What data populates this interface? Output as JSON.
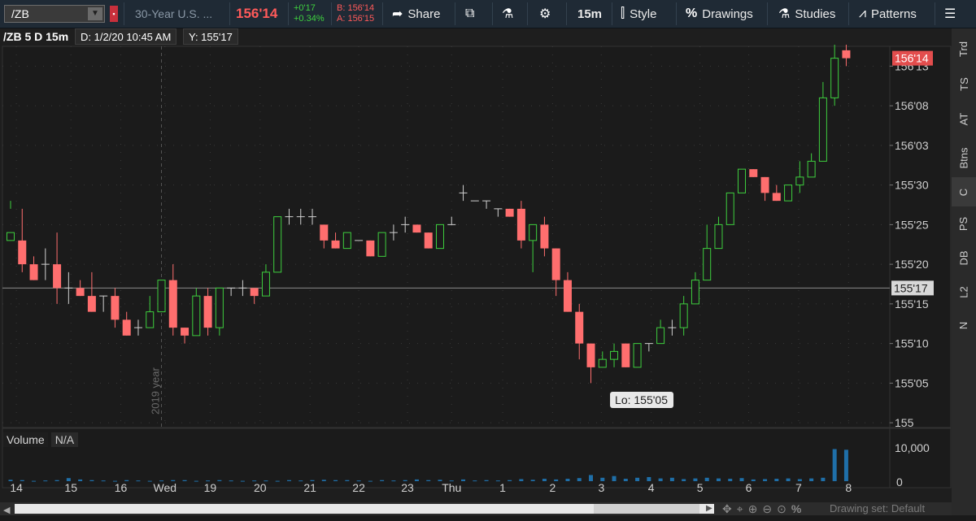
{
  "toolbar": {
    "symbol": "/ZB",
    "description": "30-Year U.S. ...",
    "last_price": "156'14",
    "change": "+0'17",
    "change_pct": "+0.34%",
    "bid": "B: 156'14",
    "ask": "A: 156'15",
    "share_label": "Share",
    "timeframe_label": "15m",
    "style_label": "Style",
    "drawings_label": "Drawings",
    "studies_label": "Studies",
    "patterns_label": "Patterns"
  },
  "chart_header": {
    "symbol_period": "/ZB 5 D 15m",
    "cursor_date": "D: 1/2/20 10:45 AM",
    "cursor_y": "Y: 155'17"
  },
  "side_tabs": [
    "Trd",
    "TS",
    "AT",
    "Btns",
    "C",
    "PS",
    "DB",
    "L2",
    "N"
  ],
  "volume": {
    "label": "Volume",
    "value": "N/A"
  },
  "scrollbar": {
    "drawing_set": "Drawing set: Default"
  },
  "colors": {
    "up": "#3ecf3e",
    "down": "#ff6e6e",
    "price_tag": "#e34d4d",
    "volume": "#1f6fa8"
  },
  "chart_data": {
    "type": "candlestick",
    "y_tick_labels": [
      "156'13",
      "156'08",
      "156'03",
      "155'30",
      "155'25",
      "155'20",
      "155'15",
      "155'10",
      "155'05",
      "155"
    ],
    "y_ticks_32nds": [
      13,
      8,
      3,
      -2,
      -7,
      -12,
      -17,
      -22,
      -27,
      -32
    ],
    "y_range_32nds_rel_156": [
      -32.5,
      15.5
    ],
    "x_tick_labels": [
      {
        "label": "14",
        "bar": 0.5
      },
      {
        "label": "15",
        "bar": 5.2
      },
      {
        "label": "16",
        "bar": 9.5
      },
      {
        "label": "Wed",
        "bar": 13.3
      },
      {
        "label": "19",
        "bar": 17.2
      },
      {
        "label": "20",
        "bar": 21.5
      },
      {
        "label": "21",
        "bar": 25.8
      },
      {
        "label": "22",
        "bar": 30.0
      },
      {
        "label": "23",
        "bar": 34.2
      },
      {
        "label": "Thu",
        "bar": 38.0
      },
      {
        "label": "1",
        "bar": 42.4
      },
      {
        "label": "2",
        "bar": 46.7
      },
      {
        "label": "3",
        "bar": 50.9
      },
      {
        "label": "4",
        "bar": 55.2
      },
      {
        "label": "5",
        "bar": 59.4
      },
      {
        "label": "6",
        "bar": 63.6
      },
      {
        "label": "7",
        "bar": 67.9
      },
      {
        "label": "8",
        "bar": 72.2
      }
    ],
    "year_marker": {
      "label": "2019 year",
      "bar": 13.0
    },
    "crosshair_price_label": "155'17",
    "crosshair_value": -15,
    "current_price_label": "156'14",
    "current_value": 14,
    "low_label": "Lo: 155'05",
    "low_bar": 52,
    "volume_ticks": [
      "10,000",
      "0"
    ],
    "volume_max": 10000,
    "candles": [
      [
        -9,
        -8,
        -5,
        -4
      ],
      [
        -9,
        -12,
        -13,
        -5
      ],
      [
        -12,
        -14,
        -14,
        -11
      ],
      [
        -12,
        -12,
        -14,
        -10
      ],
      [
        -12,
        -15,
        -17,
        -8
      ],
      [
        -15,
        -15,
        -17,
        -13
      ],
      [
        -15,
        -16,
        -16,
        -14
      ],
      [
        -16,
        -18,
        -18,
        -13
      ],
      [
        -16,
        -16,
        -18,
        -16
      ],
      [
        -16,
        -19,
        -20,
        -15
      ],
      [
        -19,
        -21,
        -21,
        -18
      ],
      [
        -20,
        -20,
        -21,
        -19
      ],
      [
        -20,
        -18,
        -20,
        -16
      ],
      [
        -18,
        -14,
        -18,
        -14
      ],
      [
        -14,
        -20,
        -21,
        -12
      ],
      [
        -20,
        -21,
        -22,
        -20
      ],
      [
        -21,
        -16,
        -21,
        -15
      ],
      [
        -16,
        -20,
        -21,
        -15
      ],
      [
        -20,
        -15,
        -21,
        -15
      ],
      [
        -15,
        -15,
        -16,
        -15
      ],
      [
        -15,
        -15,
        -16,
        -14
      ],
      [
        -15,
        -16,
        -17,
        -15
      ],
      [
        -16,
        -13,
        -16,
        -12
      ],
      [
        -13,
        -6,
        -13,
        -6
      ],
      [
        -6,
        -6,
        -7,
        -5
      ],
      [
        -6,
        -6,
        -7,
        -5
      ],
      [
        -6,
        -6,
        -7,
        -5
      ],
      [
        -7,
        -9,
        -10,
        -7
      ],
      [
        -9,
        -10,
        -10,
        -8
      ],
      [
        -10,
        -8,
        -10,
        -8
      ],
      [
        -9,
        -9,
        -9,
        -9
      ],
      [
        -9,
        -11,
        -11,
        -9
      ],
      [
        -11,
        -8,
        -11,
        -8
      ],
      [
        -8,
        -8,
        -9,
        -7
      ],
      [
        -7,
        -7,
        -8,
        -6
      ],
      [
        -7,
        -8,
        -8,
        -7
      ],
      [
        -8,
        -10,
        -10,
        -8
      ],
      [
        -10,
        -7,
        -10,
        -7
      ],
      [
        -7,
        -7,
        -7,
        -6
      ],
      [
        -3,
        -3,
        -4,
        -2
      ],
      [
        -4,
        -4,
        -4,
        -4
      ],
      [
        -4,
        -4,
        -5,
        -4
      ],
      [
        -5,
        -5,
        -6,
        -5
      ],
      [
        -5,
        -6,
        -6,
        -5
      ],
      [
        -5,
        -9,
        -10,
        -4
      ],
      [
        -9,
        -7,
        -13,
        -7
      ],
      [
        -7,
        -10,
        -11,
        -6
      ],
      [
        -10,
        -14,
        -16,
        -10
      ],
      [
        -14,
        -18,
        -18,
        -13
      ],
      [
        -18,
        -22,
        -24,
        -17
      ],
      [
        -22,
        -25,
        -27,
        -22
      ],
      [
        -25,
        -24,
        -25,
        -23
      ],
      [
        -24,
        -23,
        -25,
        -22
      ],
      [
        -22,
        -25,
        -25,
        -22
      ],
      [
        -25,
        -22,
        -25,
        -22
      ],
      [
        -22,
        -22,
        -23,
        -22
      ],
      [
        -22,
        -20,
        -21,
        -19
      ],
      [
        -20,
        -20,
        -21,
        -19
      ],
      [
        -20,
        -17,
        -21,
        -16
      ],
      [
        -17,
        -14,
        -17,
        -13
      ],
      [
        -14,
        -10,
        -14,
        -7
      ],
      [
        -10,
        -7,
        -10,
        -6
      ],
      [
        -7,
        -3,
        -7,
        -3
      ],
      [
        -3,
        0,
        -3,
        0
      ],
      [
        0,
        -1,
        -1,
        0
      ],
      [
        -1,
        -3,
        -4,
        -1
      ],
      [
        -3,
        -4,
        -4,
        -2
      ],
      [
        -4,
        -2,
        -4,
        -2
      ],
      [
        -2,
        -1,
        -3,
        1
      ],
      [
        -1,
        1,
        -1,
        2
      ],
      [
        1,
        9,
        1,
        11
      ],
      [
        9,
        14,
        8,
        16
      ],
      [
        15,
        14,
        13,
        16
      ]
    ],
    "volume": [
      400,
      300,
      100,
      200,
      300,
      900,
      500,
      300,
      200,
      100,
      300,
      200,
      100,
      200,
      300,
      300,
      100,
      200,
      300,
      200,
      100,
      200,
      200,
      100,
      300,
      200,
      300,
      400,
      300,
      300,
      200,
      100,
      300,
      200,
      300,
      500,
      300,
      400,
      200,
      500,
      200,
      300,
      200,
      300,
      600,
      400,
      700,
      500,
      700,
      900,
      1800,
      1000,
      1500,
      700,
      1000,
      1200,
      800,
      1000,
      600,
      800,
      1000,
      800,
      700,
      900,
      500,
      600,
      700,
      800,
      600,
      800,
      1000,
      9400,
      9200
    ]
  }
}
